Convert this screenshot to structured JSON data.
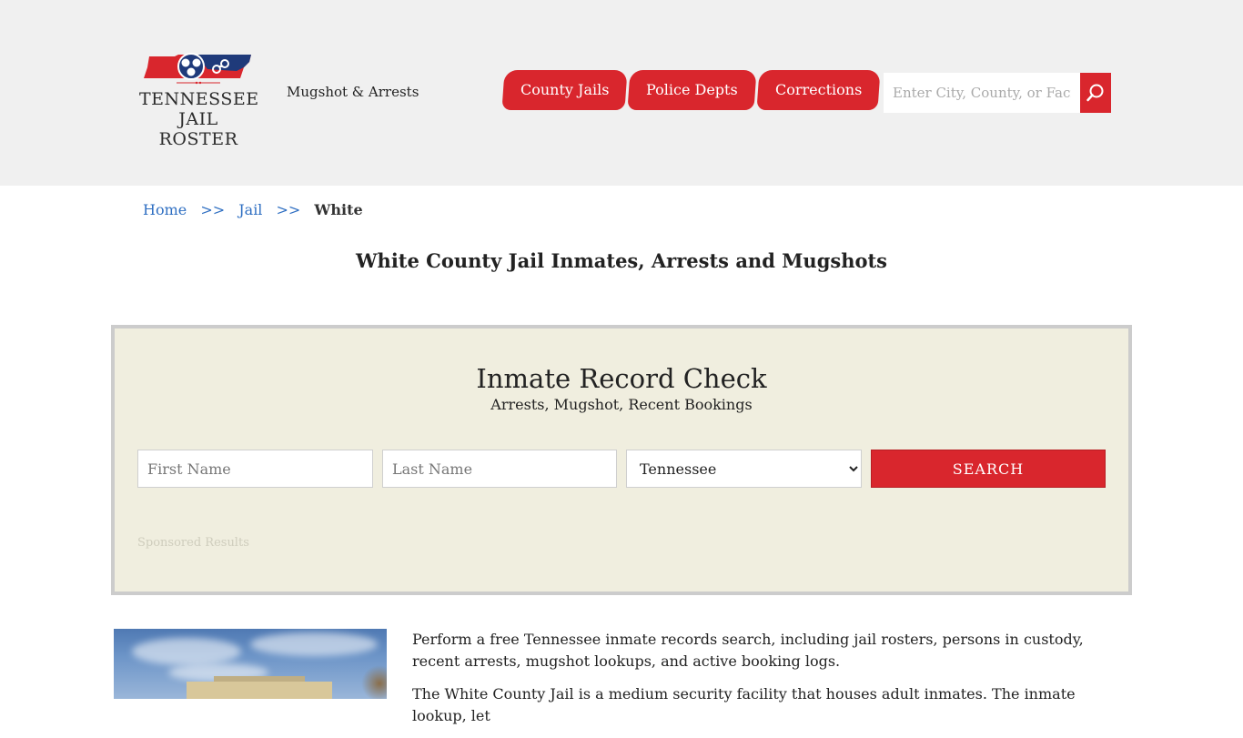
{
  "header": {
    "logo": {
      "line1": "TENNESSEE",
      "line2": "JAIL ROSTER"
    },
    "tagline": "Mugshot & Arrests",
    "nav": [
      {
        "label": "County Jails"
      },
      {
        "label": "Police Depts"
      },
      {
        "label": "Corrections"
      }
    ],
    "search": {
      "placeholder": "Enter City, County, or Facility",
      "icon": "search-icon"
    }
  },
  "breadcrumb": {
    "items": [
      {
        "label": "Home"
      },
      {
        "label": "Jail"
      }
    ],
    "separator": ">>",
    "current": "White"
  },
  "page_title": "White County Jail Inmates, Arrests and Mugshots",
  "record_check": {
    "title": "Inmate Record Check",
    "subtitle": "Arrests, Mugshot, Recent Bookings",
    "first_name_placeholder": "First Name",
    "last_name_placeholder": "Last Name",
    "state_selected": "Tennessee",
    "search_label": "SEARCH",
    "sponsored": "Sponsored Results"
  },
  "intro": {
    "paragraphs": [
      "Perform a free Tennessee inmate records search, including jail rosters, persons in custody, recent arrests, mugshot lookups, and active booking logs.",
      "The White County Jail is a medium security facility that houses adult inmates. The inmate lookup, let"
    ]
  },
  "colors": {
    "brand_red": "#d9262d",
    "header_bg": "#f0f0f0",
    "record_box_bg": "#f0eedf",
    "link_blue": "#2f6fc2"
  }
}
